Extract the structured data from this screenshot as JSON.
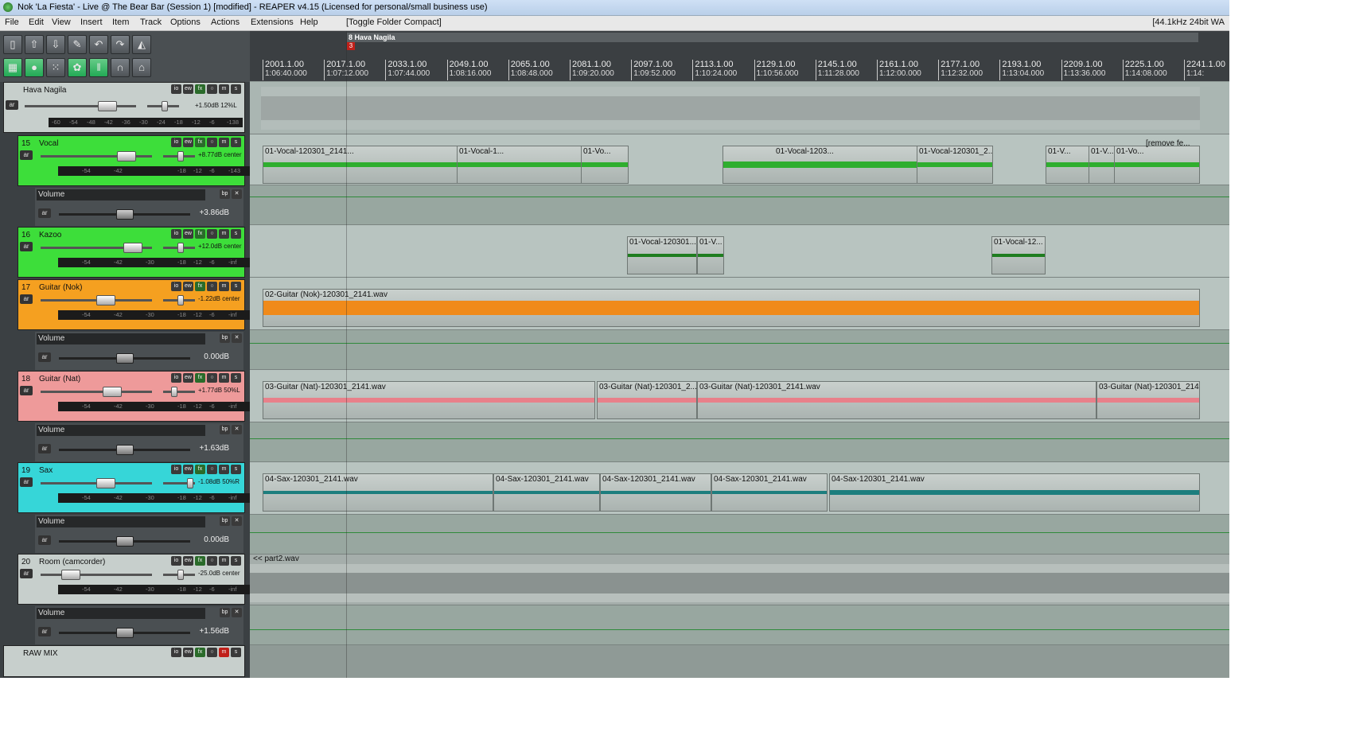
{
  "window": {
    "title": "Nok 'La Fiesta' - Live @ The Bear Bar (Session 1) [modified] - REAPER v4.15 (Licensed for personal/small business use)",
    "format": "[44.1kHz 24bit WA"
  },
  "menu": {
    "items": [
      "File",
      "Edit",
      "View",
      "Insert",
      "Item",
      "Track",
      "Options",
      "Actions",
      "Extensions",
      "Help"
    ],
    "action": "[Toggle Folder Compact]"
  },
  "toolbar": {
    "icons": [
      "new-project-icon",
      "open-project-icon",
      "save-project-icon",
      "settings-icon",
      "undo-icon",
      "redo-icon",
      "metronome-icon",
      "grid-icon",
      "snap-icon",
      "envelope-icon",
      "ripple-icon",
      "lock-icon",
      "loop-icon",
      "midi-icon"
    ]
  },
  "ruler": {
    "region_label": "8 Hava Nagila",
    "marker_label": "3",
    "ticks": [
      {
        "bar": "2001.1.00",
        "time": "1:06:40.000"
      },
      {
        "bar": "2017.1.00",
        "time": "1:07:12.000"
      },
      {
        "bar": "2033.1.00",
        "time": "1:07:44.000"
      },
      {
        "bar": "2049.1.00",
        "time": "1:08:16.000"
      },
      {
        "bar": "2065.1.00",
        "time": "1:08:48.000"
      },
      {
        "bar": "2081.1.00",
        "time": "1:09:20.000"
      },
      {
        "bar": "2097.1.00",
        "time": "1:09:52.000"
      },
      {
        "bar": "2113.1.00",
        "time": "1:10:24.000"
      },
      {
        "bar": "2129.1.00",
        "time": "1:10:56.000"
      },
      {
        "bar": "2145.1.00",
        "time": "1:11:28.000"
      },
      {
        "bar": "2161.1.00",
        "time": "1:12:00.000"
      },
      {
        "bar": "2177.1.00",
        "time": "1:12:32.000"
      },
      {
        "bar": "2193.1.00",
        "time": "1:13:04.000"
      },
      {
        "bar": "2209.1.00",
        "time": "1:13:36.000"
      },
      {
        "bar": "2225.1.00",
        "time": "1:14:08.000"
      },
      {
        "bar": "2241.1.00",
        "time": "1:14:"
      }
    ]
  },
  "tracks": [
    {
      "num": "",
      "name": "Hava Nagila",
      "vol": "+1.50dB 12%L",
      "meter": [
        "-60",
        "-54",
        "-48",
        "-42",
        "-36",
        "-30",
        "-24",
        "-18",
        "-12",
        "-6",
        "-138"
      ],
      "color": "#c7cfcc"
    },
    {
      "num": "15",
      "name": "Vocal",
      "vol": "+8.77dB center",
      "meter": [
        "-54",
        "-42",
        "-18",
        "-12",
        "-6",
        "-143"
      ],
      "color": "#3dde3a",
      "env": {
        "name": "Volume",
        "value": "+3.86dB"
      }
    },
    {
      "num": "16",
      "name": "Kazoo",
      "vol": "+12.0dB center",
      "meter": [
        "-54",
        "-42",
        "-30",
        "-18",
        "-12",
        "-6",
        "-inf"
      ],
      "color": "#3dde3a"
    },
    {
      "num": "17",
      "name": "Guitar (Nok)",
      "vol": "-1.22dB center",
      "meter": [
        "-54",
        "-42",
        "-30",
        "-18",
        "-12",
        "-6",
        "-inf"
      ],
      "color": "#f5a020",
      "env": {
        "name": "Volume",
        "value": "0.00dB"
      }
    },
    {
      "num": "18",
      "name": "Guitar (Nat)",
      "vol": "+1.77dB 50%L",
      "meter": [
        "-54",
        "-42",
        "-30",
        "-18",
        "-12",
        "-6",
        "-inf"
      ],
      "color": "#ee9a9a",
      "env": {
        "name": "Volume",
        "value": "+1.63dB"
      }
    },
    {
      "num": "19",
      "name": "Sax",
      "vol": "-1.08dB 50%R",
      "meter": [
        "-54",
        "-42",
        "-30",
        "-18",
        "-12",
        "-6",
        "-inf"
      ],
      "color": "#36d6d8",
      "env": {
        "name": "Volume",
        "value": "0.00dB"
      }
    },
    {
      "num": "20",
      "name": "Room (camcorder)",
      "vol": "-25.0dB center",
      "meter": [
        "-54",
        "-42",
        "-30",
        "-18",
        "-12",
        "-6",
        "-inf"
      ],
      "color": "#c7cfcc",
      "env": {
        "name": "Volume",
        "value": "+1.56dB"
      }
    },
    {
      "num": "",
      "name": "RAW MIX",
      "vol": "",
      "meter": [],
      "color": "#c7cfcc"
    }
  ],
  "items": {
    "vocal": [
      "01-Vocal-120301_2141...",
      "01-Vocal-1...",
      "01-Vo...",
      "01-Vocal-1203...",
      "01-Vocal-120301_2...",
      "01-V...",
      "01-V...",
      "01-Vo...",
      "[remove fe..."
    ],
    "kazoo": [
      "01-Vocal-120301...",
      "01-V...",
      "01-Vocal-12..."
    ],
    "guitar_nok": [
      "02-Guitar (Nok)-120301_2141.wav"
    ],
    "guitar_nat": [
      "03-Guitar (Nat)-120301_2141.wav",
      "03-Guitar (Nat)-120301_2...",
      "03-Guitar (Nat)-120301_2141.wav",
      "03-Guitar (Nat)-120301_214..."
    ],
    "sax": [
      "04-Sax-120301_2141.wav",
      "04-Sax-120301_2141.wav",
      "04-Sax-120301_2141.wav",
      "04-Sax-120301_2141.wav",
      "04-Sax-120301_2141.wav"
    ],
    "room": [
      "<< part2.wav"
    ]
  },
  "colors": {
    "vocal_wave": "#2fae2f",
    "kazoo_wave": "#1f7d1f",
    "guitar_nok_wave": "#f08a1a",
    "guitar_nat_wave": "#e8808a",
    "sax_wave": "#1d7e7e",
    "room_wave": "#8a9290",
    "envelope": "#2f8a3a"
  }
}
